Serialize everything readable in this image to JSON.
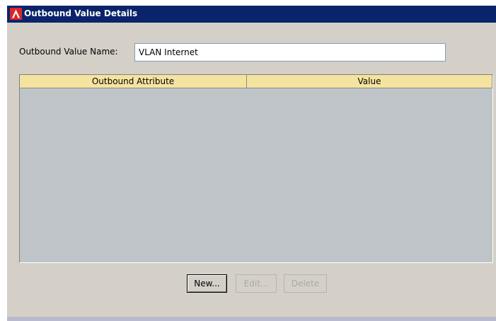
{
  "window": {
    "title": "Outbound Value Details",
    "icon": "app-logo-icon",
    "title_bar_color": "#0a246a"
  },
  "form": {
    "name_label": "Outbound Value Name:",
    "name_value": "VLAN Internet"
  },
  "table": {
    "columns": [
      "Outbound Attribute",
      "Value"
    ],
    "rows": [],
    "header_color": "#f5e4a0"
  },
  "buttons": {
    "new": "New...",
    "edit": "Edit...",
    "delete": "Delete"
  }
}
